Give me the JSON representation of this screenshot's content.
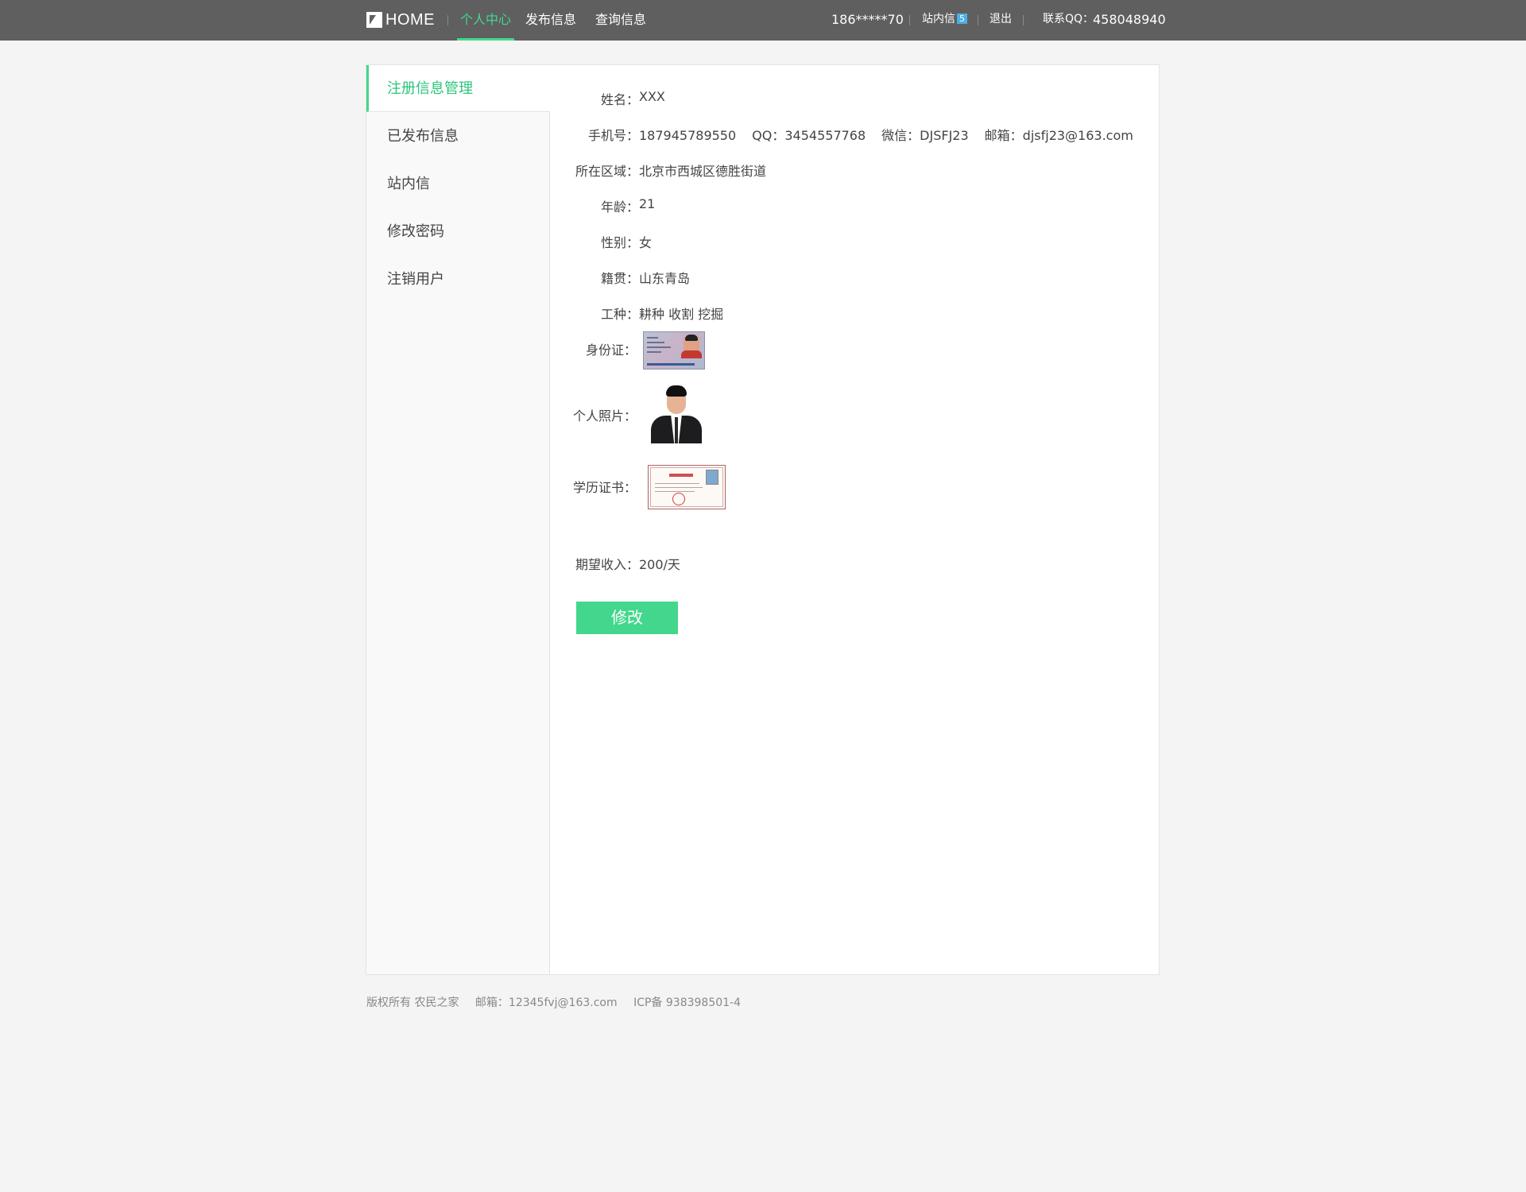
{
  "header": {
    "logo_text": "HOME",
    "nav": [
      {
        "label": "个人中心",
        "active": true
      },
      {
        "label": "发布信息",
        "active": false
      },
      {
        "label": "查询信息",
        "active": false
      }
    ],
    "phone": "186*****70",
    "messages_label": "站内信",
    "messages_count": "5",
    "logout_label": "退出",
    "qq_label": "联系QQ：",
    "qq_number": "458048940",
    "accent_color": "#43d78d",
    "bar_color": "#5f5f5f"
  },
  "sidebar": {
    "items": [
      {
        "label": "注册信息管理",
        "active": true
      },
      {
        "label": "已发布信息",
        "active": false
      },
      {
        "label": "站内信",
        "active": false
      },
      {
        "label": "修改密码",
        "active": false
      },
      {
        "label": "注销用户",
        "active": false
      }
    ]
  },
  "profile": {
    "name_label": "姓名：",
    "name": "XXX",
    "phone_label": "手机号：",
    "phone": "187945789550",
    "qq_label": "QQ：",
    "qq": "3454557768",
    "wechat_label": "微信：",
    "wechat": "DJSFJ23",
    "email_label": "邮箱：",
    "email": "djsfj23@163.com",
    "region_label": "所在区域：",
    "region": "北京市西城区德胜街道",
    "age_label": "年龄：",
    "age": "21",
    "gender_label": "性别：",
    "gender": "女",
    "hometown_label": "籍贯：",
    "hometown": "山东青岛",
    "trade_label": "工种：",
    "trade": "耕种 收割 挖掘",
    "idcard_label": "身份证：",
    "photo_label": "个人照片：",
    "diploma_label": "学历证书：",
    "income_label": "期望收入：",
    "income": "200/天",
    "edit_button": "修改"
  },
  "footer": {
    "copyright": "版权所有 农民之家",
    "email": "邮箱：12345fvj@163.com",
    "icp": "ICP备 938398501-4"
  }
}
